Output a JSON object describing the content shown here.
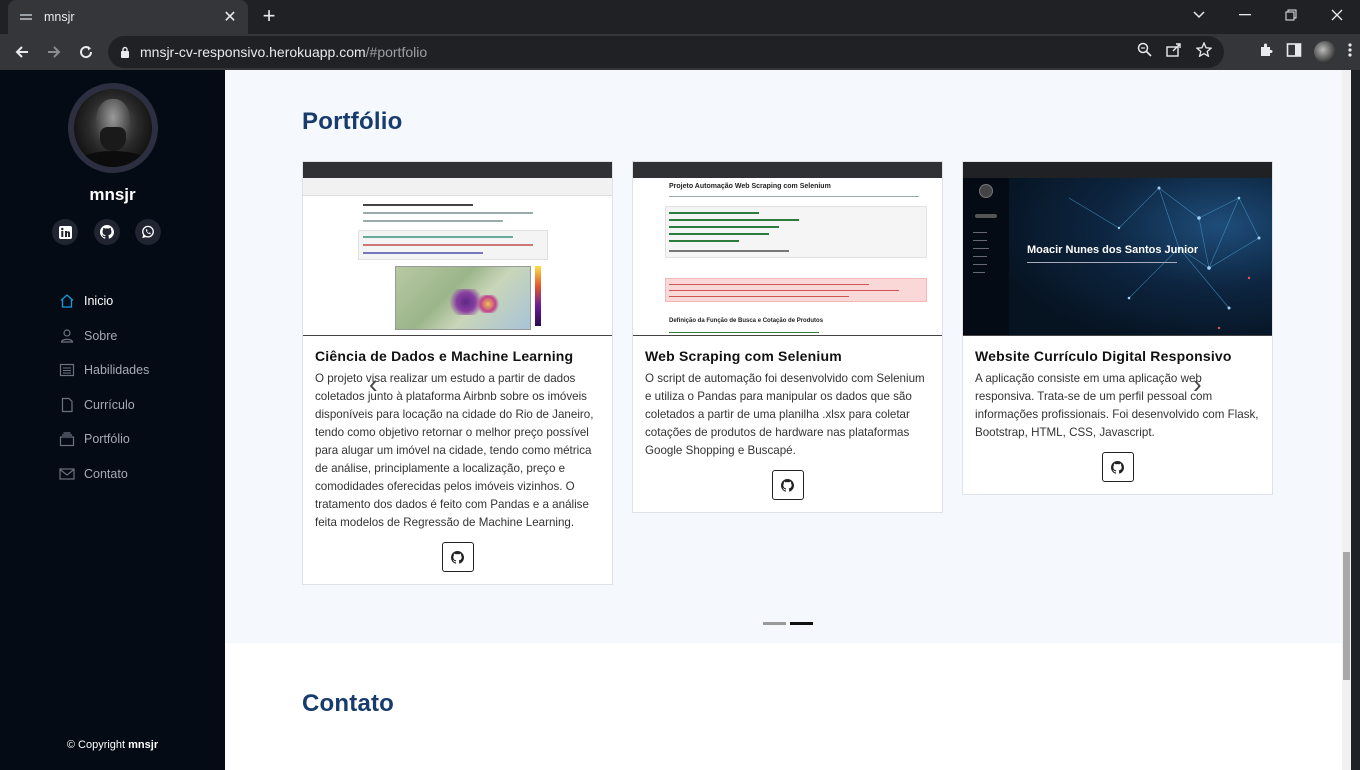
{
  "browser": {
    "tab_title": "mnsjr",
    "url_domain": "mnsjr-cv-responsivo.herokuapp.com",
    "url_path": "/#portfolio"
  },
  "sidebar": {
    "name": "mnsjr",
    "nav": [
      {
        "label": "Inicio",
        "icon": "home-icon",
        "active": true
      },
      {
        "label": "Sobre",
        "icon": "person-icon",
        "active": false
      },
      {
        "label": "Habilidades",
        "icon": "list-icon",
        "active": false
      },
      {
        "label": "Currículo",
        "icon": "file-icon",
        "active": false
      },
      {
        "label": "Portfólio",
        "icon": "collection-icon",
        "active": false
      },
      {
        "label": "Contato",
        "icon": "envelope-icon",
        "active": false
      }
    ],
    "copyright_prefix": "© Copyright ",
    "copyright_name": "mnsjr"
  },
  "portfolio": {
    "title": "Portfólio",
    "cards": [
      {
        "title": "Ciência de Dados e Machine Learning",
        "description": "O projeto visa realizar um estudo a partir de dados coletados junto à plataforma Airbnb sobre os imóveis disponíveis para locação na cidade do Rio de Janeiro, tendo como objetivo retornar o melhor preço possível para alugar um imóvel na cidade, tendo como métrica de análise, principlamente a localização, preço e comodidades oferecidas pelos imóveis vizinhos. O tratamento dos dados é feito com Pandas e a análise feita modelos de Regressão de Machine Learning."
      },
      {
        "title": "Web Scraping com Selenium",
        "description": "O script de automação foi desenvolvido com Selenium e utiliza o Pandas para manipular os dados que são coletados a partir de uma planilha .xlsx para coletar cotações de produtos de hardware nas plataformas Google Shopping e Buscapé.",
        "shot_heading": "Projeto Automação Web Scraping com Selenium",
        "shot_subheading": "Definição da Função de Busca e Cotação de Produtos"
      },
      {
        "title": "Website Currículo Digital Responsivo",
        "description": "A aplicação consiste em uma aplicação web responsiva. Trata-se de um perfil pessoal com informações profissionais. Foi desenvolvido com Flask, Bootstrap, HTML, CSS, Javascript.",
        "shot_heading": "Moacir Nunes dos Santos Junior"
      }
    ],
    "active_slide": 1
  },
  "contato": {
    "title": "Contato"
  },
  "colors": {
    "sidebar_bg": "#040b14",
    "accent": "#149ddd",
    "title": "#173b6c",
    "portfolio_bg": "#f5f8fd"
  }
}
